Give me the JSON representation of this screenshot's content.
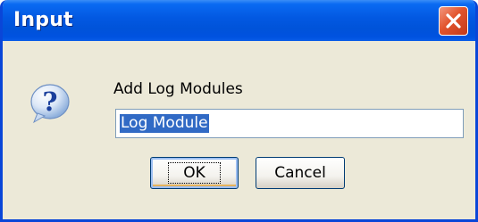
{
  "window": {
    "title": "Input"
  },
  "icons": {
    "question": "question-mark-icon",
    "close": "close-icon"
  },
  "dialog": {
    "prompt": "Add Log Modules",
    "input_value": "Log Module",
    "ok_label": "OK",
    "cancel_label": "Cancel"
  },
  "colors": {
    "title_bar": "#0053d9",
    "close_button": "#e2542c",
    "selection": "#316ac5",
    "dialog_bg": "#ece9d8"
  }
}
